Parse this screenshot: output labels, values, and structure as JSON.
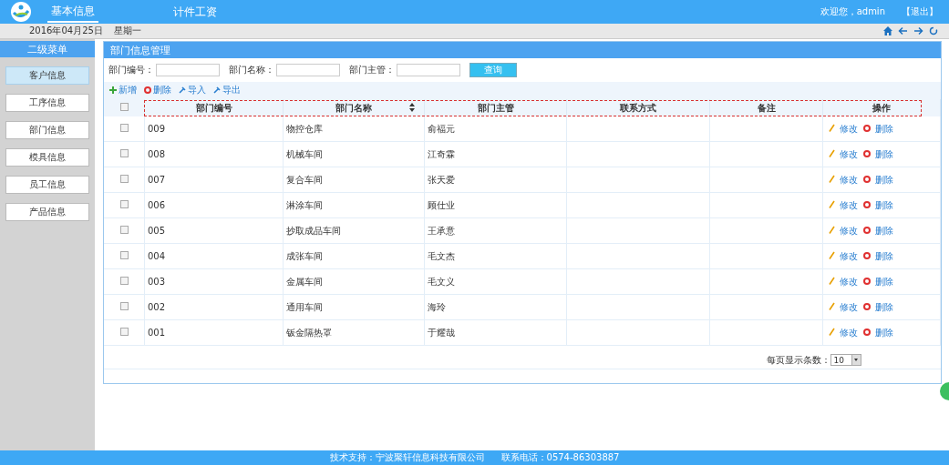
{
  "header": {
    "nav": [
      {
        "label": "基本信息",
        "selected": true
      },
      {
        "label": "计件工资",
        "selected": false
      }
    ],
    "welcome": "欢迎您，admin",
    "logout": "【退出】"
  },
  "date_bar": {
    "date": "2016年04月25日",
    "weekday": "星期一"
  },
  "sidebar": {
    "title": "二级菜单",
    "items": [
      {
        "label": "客户信息",
        "selected": true
      },
      {
        "label": "工序信息",
        "selected": false
      },
      {
        "label": "部门信息",
        "selected": false
      },
      {
        "label": "模具信息",
        "selected": false
      },
      {
        "label": "员工信息",
        "selected": false
      },
      {
        "label": "产品信息",
        "selected": false
      }
    ]
  },
  "panel": {
    "title": "部门信息管理",
    "search": [
      {
        "label": "部门编号："
      },
      {
        "label": "部门名称："
      },
      {
        "label": "部门主管："
      }
    ],
    "search_button": "查询",
    "toolbar": [
      {
        "kind": "add",
        "label": "新增"
      },
      {
        "kind": "delete",
        "label": "删除"
      },
      {
        "kind": "import",
        "label": "导入"
      },
      {
        "kind": "export",
        "label": "导出"
      }
    ],
    "table": {
      "select_all_checked": false,
      "columns": [
        {
          "label": "部门编号",
          "sortable": false
        },
        {
          "label": "部门名称",
          "sortable": true
        },
        {
          "label": "部门主管",
          "sortable": false
        },
        {
          "label": "联系方式",
          "sortable": false
        },
        {
          "label": "备注",
          "sortable": false
        },
        {
          "label": "操作",
          "sortable": false
        }
      ],
      "rows": [
        {
          "checked": false,
          "cells": [
            "009",
            "物控仓库",
            "俞福元",
            "",
            ""
          ],
          "actions": [
            "修改",
            "删除"
          ]
        },
        {
          "checked": false,
          "cells": [
            "008",
            "机械车间",
            "江奇霖",
            "",
            ""
          ],
          "actions": [
            "修改",
            "删除"
          ]
        },
        {
          "checked": false,
          "cells": [
            "007",
            "复合车间",
            "张天爱",
            "",
            ""
          ],
          "actions": [
            "修改",
            "删除"
          ]
        },
        {
          "checked": false,
          "cells": [
            "006",
            "淋涂车间",
            "顾仕业",
            "",
            ""
          ],
          "actions": [
            "修改",
            "删除"
          ]
        },
        {
          "checked": false,
          "cells": [
            "005",
            "抄取成品车间",
            "王承意",
            "",
            ""
          ],
          "actions": [
            "修改",
            "删除"
          ]
        },
        {
          "checked": false,
          "cells": [
            "004",
            "成张车间",
            "毛文杰",
            "",
            ""
          ],
          "actions": [
            "修改",
            "删除"
          ]
        },
        {
          "checked": false,
          "cells": [
            "003",
            "金属车间",
            "毛文义",
            "",
            ""
          ],
          "actions": [
            "修改",
            "删除"
          ]
        },
        {
          "checked": false,
          "cells": [
            "002",
            "通用车间",
            "海玲",
            "",
            ""
          ],
          "actions": [
            "修改",
            "删除"
          ]
        },
        {
          "checked": false,
          "cells": [
            "001",
            "钣金隔热罩",
            "于耀哉",
            "",
            ""
          ],
          "actions": [
            "修改",
            "删除"
          ]
        }
      ]
    },
    "page_size_label": "每页显示条数：",
    "page_size": "10"
  },
  "footer": {
    "support": "技术支持：宁波聚轩信息科技有限公司",
    "phone": "联系电话：0574-86303887"
  }
}
